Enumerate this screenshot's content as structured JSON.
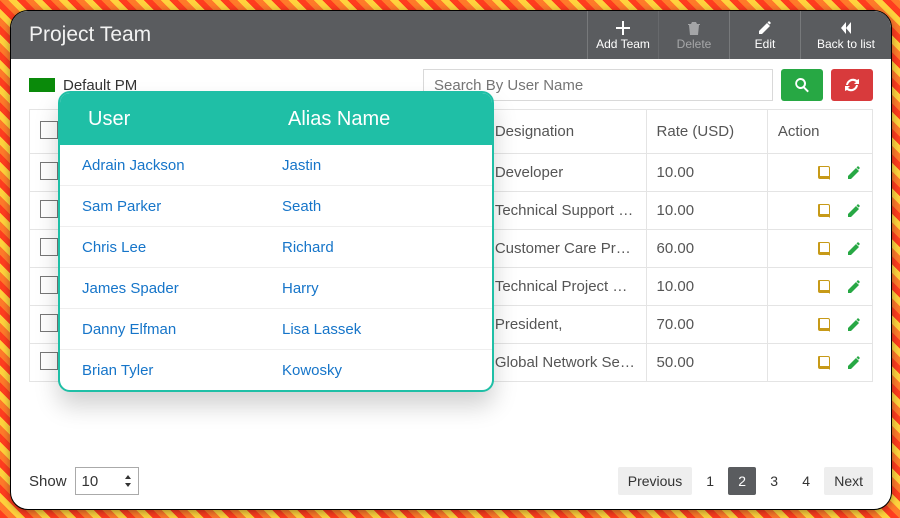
{
  "header": {
    "title": "Project Team",
    "buttons": {
      "add": "Add Team",
      "delete": "Delete",
      "edit": "Edit",
      "back": "Back to list"
    }
  },
  "legend": {
    "label": "Default PM"
  },
  "search": {
    "placeholder": "Search By User Name"
  },
  "columns": {
    "user": "User",
    "alias": "Alias Name",
    "desig": "Designation",
    "rate": "Rate (USD)",
    "action": "Action"
  },
  "rows": [
    {
      "user": "",
      "alias": "",
      "desig": "Developer",
      "rate": "10.00"
    },
    {
      "user": "",
      "alias": "",
      "desig": "Technical Support Spe..",
      "rate": "10.00"
    },
    {
      "user": "",
      "alias": "",
      "desig": "Customer Care Profes..",
      "rate": "60.00"
    },
    {
      "user": "",
      "alias": "",
      "desig": "Technical Project Man..",
      "rate": "10.00"
    },
    {
      "user": "",
      "alias": "",
      "desig": "President,",
      "rate": "70.00"
    },
    {
      "user": "",
      "alias": "",
      "desig": "Global Network Servic..",
      "rate": "50.00"
    }
  ],
  "popover": {
    "headers": {
      "user": "User",
      "alias": "Alias Name"
    },
    "rows": [
      {
        "user": "Adrain Jackson",
        "alias": "Jastin"
      },
      {
        "user": "Sam Parker",
        "alias": "Seath"
      },
      {
        "user": "Chris Lee",
        "alias": "Richard"
      },
      {
        "user": "James Spader",
        "alias": "Harry"
      },
      {
        "user": "Danny Elfman",
        "alias": "Lisa Lassek"
      },
      {
        "user": "Brian Tyler",
        "alias": "Kowosky"
      }
    ]
  },
  "footer": {
    "show_label": "Show",
    "page_size": "10",
    "prev": "Previous",
    "next": "Next",
    "pages": [
      "1",
      "2",
      "3",
      "4"
    ],
    "active_page": "2"
  }
}
